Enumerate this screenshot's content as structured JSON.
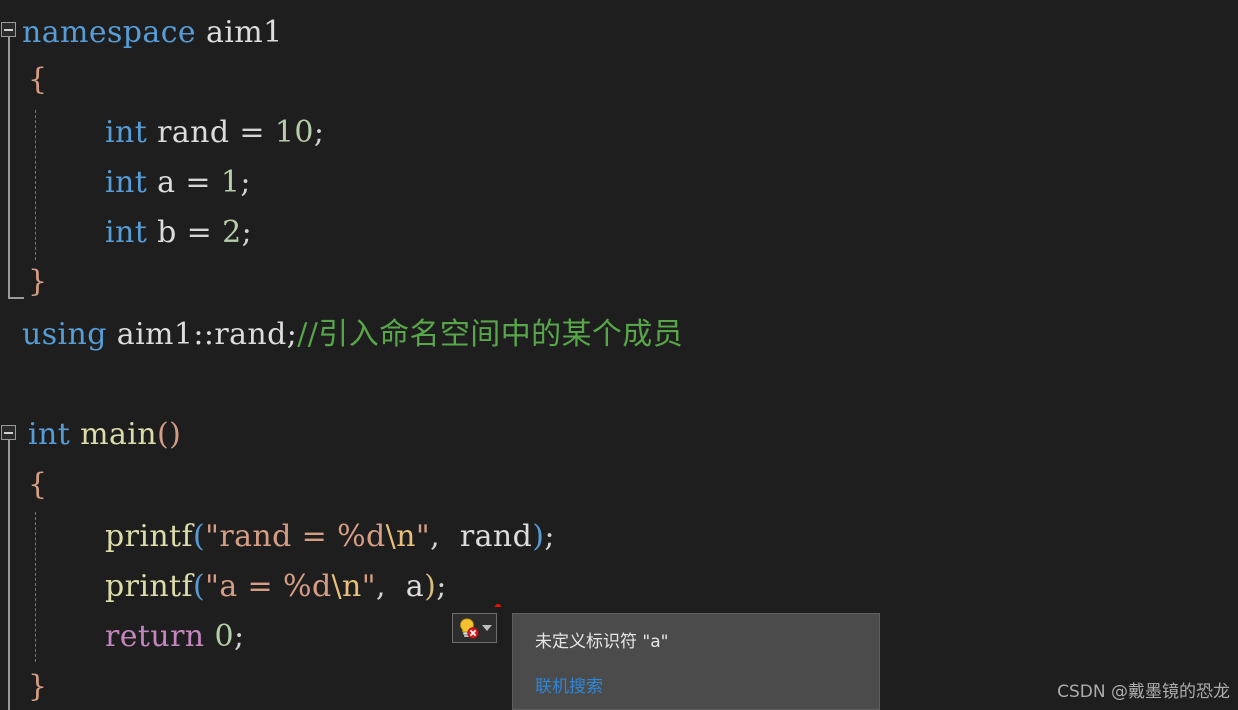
{
  "editor": {
    "background": "#1e1e1e",
    "font_size_px": 30,
    "line_height_px": 50,
    "colors": {
      "keyword": "#569cd6",
      "control_keyword": "#c586c0",
      "identifier": "#dcdcdc",
      "function": "#dcdcaa",
      "number": "#b5cea8",
      "string": "#d69d85",
      "escape": "#e8c07a",
      "comment": "#57a64a",
      "error_squiggle": "#e51400"
    },
    "lines": [
      {
        "id": "line-namespace",
        "fold_marker": "collapse-minus",
        "tokens": [
          {
            "text": "namespace ",
            "kind": "keyword"
          },
          {
            "text": "aim1",
            "kind": "identifier"
          }
        ]
      },
      {
        "id": "line-ns-open-brace",
        "tokens": [
          {
            "text": "{",
            "kind": "brace-orange"
          }
        ]
      },
      {
        "id": "line-int-rand",
        "tokens": [
          {
            "text": "int",
            "kind": "keyword"
          },
          {
            "text": " rand ",
            "kind": "identifier"
          },
          {
            "text": "= ",
            "kind": "punctuation"
          },
          {
            "text": "10",
            "kind": "number"
          },
          {
            "text": ";",
            "kind": "punctuation"
          }
        ]
      },
      {
        "id": "line-int-a",
        "tokens": [
          {
            "text": "int",
            "kind": "keyword"
          },
          {
            "text": " a ",
            "kind": "identifier"
          },
          {
            "text": "= ",
            "kind": "punctuation"
          },
          {
            "text": "1",
            "kind": "number"
          },
          {
            "text": ";",
            "kind": "punctuation"
          }
        ]
      },
      {
        "id": "line-int-b",
        "tokens": [
          {
            "text": "int",
            "kind": "keyword"
          },
          {
            "text": " b ",
            "kind": "identifier"
          },
          {
            "text": "= ",
            "kind": "punctuation"
          },
          {
            "text": "2",
            "kind": "number"
          },
          {
            "text": ";",
            "kind": "punctuation"
          }
        ]
      },
      {
        "id": "line-ns-close-brace",
        "tokens": [
          {
            "text": "}",
            "kind": "brace-orange"
          }
        ]
      },
      {
        "id": "line-using",
        "tokens": [
          {
            "text": "using",
            "kind": "keyword"
          },
          {
            "text": " aim1::rand;",
            "kind": "identifier"
          },
          {
            "text": "//引入命名空间中的某个成员",
            "kind": "comment"
          }
        ]
      },
      {
        "id": "line-main",
        "fold_marker": "collapse-minus",
        "tokens": [
          {
            "text": "int",
            "kind": "keyword"
          },
          {
            "text": " ",
            "kind": "identifier"
          },
          {
            "text": "main",
            "kind": "function"
          },
          {
            "text": "()",
            "kind": "brace-orange"
          }
        ]
      },
      {
        "id": "line-main-open-brace",
        "tokens": [
          {
            "text": "{",
            "kind": "brace-orange"
          }
        ]
      },
      {
        "id": "line-printf-rand",
        "tokens": [
          {
            "text": "printf",
            "kind": "function"
          },
          {
            "text": "(",
            "kind": "brace-blue"
          },
          {
            "text": "\"rand = %d",
            "kind": "string"
          },
          {
            "text": "\\n",
            "kind": "escape"
          },
          {
            "text": "\"",
            "kind": "string"
          },
          {
            "text": ", ",
            "kind": "punctuation"
          },
          {
            "text": " rand",
            "kind": "identifier"
          },
          {
            "text": ")",
            "kind": "brace-blue"
          },
          {
            "text": ";",
            "kind": "punctuation"
          }
        ]
      },
      {
        "id": "line-printf-a",
        "tokens": [
          {
            "text": "printf",
            "kind": "function"
          },
          {
            "text": "(",
            "kind": "brace-blue"
          },
          {
            "text": "\"a = %d",
            "kind": "string"
          },
          {
            "text": "\\n",
            "kind": "escape"
          },
          {
            "text": "\"",
            "kind": "string"
          },
          {
            "text": ", ",
            "kind": "punctuation"
          },
          {
            "text": " a",
            "kind": "identifier"
          },
          {
            "text": ")",
            "kind": "brace-yellow"
          },
          {
            "text": ";",
            "kind": "punctuation"
          }
        ],
        "has_error_squiggle": true
      },
      {
        "id": "line-return",
        "tokens": [
          {
            "text": "return",
            "kind": "control-keyword"
          },
          {
            "text": " ",
            "kind": "identifier"
          },
          {
            "text": "0",
            "kind": "number"
          },
          {
            "text": ";",
            "kind": "punctuation"
          }
        ]
      },
      {
        "id": "line-main-close-brace",
        "tokens": [
          {
            "text": "}",
            "kind": "brace-orange"
          }
        ]
      }
    ]
  },
  "quick_action": {
    "icon": "lightbulb-error-icon",
    "dropdown_icon": "chevron-down-icon"
  },
  "error_tooltip": {
    "message": "未定义标识符 \"a\"",
    "link_label": "联机搜索"
  },
  "watermark": {
    "text": "CSDN @戴墨镜的恐龙"
  }
}
